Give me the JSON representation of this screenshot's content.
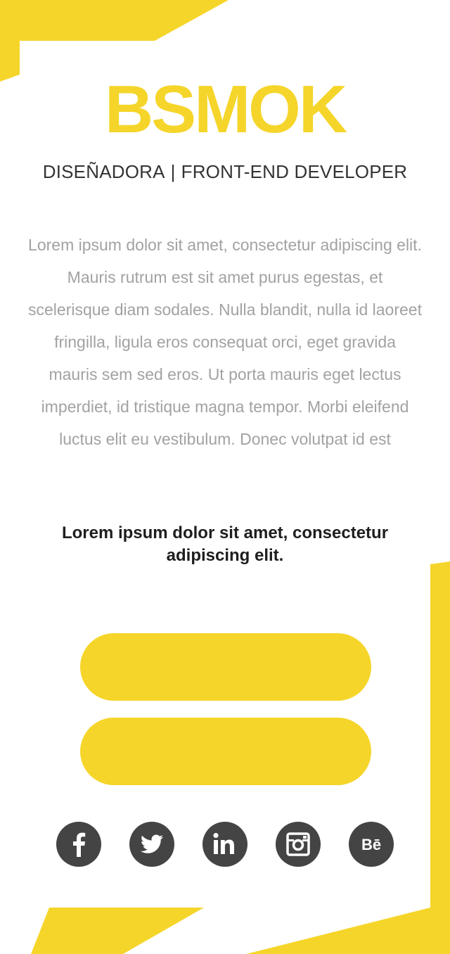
{
  "theme": {
    "accent": "#f5d52a",
    "icon_bg": "#444444",
    "icon_fg": "#ffffff"
  },
  "header": {
    "brand": "BSMOK",
    "role_1": "DISEÑADORA",
    "separator": "|",
    "role_2": "FRONT-END DEVELOPER"
  },
  "main": {
    "body": "Lorem ipsum dolor sit amet, consectetur adipiscing elit. Mauris rutrum est sit amet purus egestas, et scelerisque diam sodales. Nulla blandit, nulla id laoreet fringilla, ligula eros consequat orci, eget gravida mauris sem sed eros. Ut porta mauris eget lectus imperdiet, id tristique magna tempor. Morbi eleifend luctus elit eu vestibulum. Donec volutpat id est",
    "tagline": "Lorem ipsum dolor sit amet, consectetur adipiscing elit."
  },
  "actions": {
    "primary_label": "",
    "secondary_label": ""
  },
  "social": {
    "icons": [
      "facebook-icon",
      "twitter-icon",
      "linkedin-icon",
      "instagram-icon",
      "behance-icon"
    ],
    "behance_glyph": "Bē"
  }
}
